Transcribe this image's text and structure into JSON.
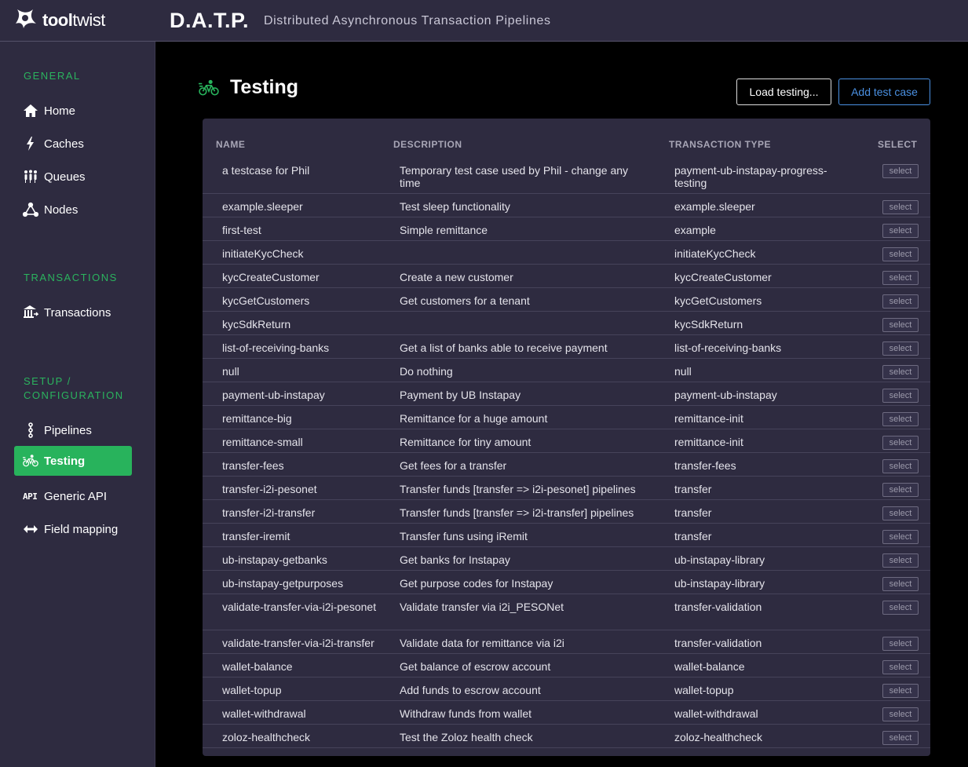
{
  "header": {
    "logo_text_bold": "tool",
    "logo_text_light": "twist",
    "app_title": "D.A.T.P.",
    "app_subtitle": "Distributed Asynchronous Transaction Pipelines"
  },
  "colors": {
    "header_bg": "#2e2b40",
    "accent_green": "#28b35c",
    "link_blue": "#4a90e2"
  },
  "sidebar": {
    "sections": [
      {
        "title": "GENERAL"
      },
      {
        "title": "TRANSACTIONS"
      },
      {
        "title": "SETUP /",
        "title2": "CONFIGURATION"
      }
    ],
    "items": [
      {
        "label": "Home",
        "icon": "home-icon"
      },
      {
        "label": "Caches",
        "icon": "bolt-icon"
      },
      {
        "label": "Queues",
        "icon": "people-icon"
      },
      {
        "label": "Nodes",
        "icon": "nodes-icon"
      },
      {
        "label": "Transactions",
        "icon": "bank-icon"
      },
      {
        "label": "Pipelines",
        "icon": "pipeline-icon"
      },
      {
        "label": "Testing",
        "icon": "bicycle-icon",
        "active": true
      },
      {
        "label": "Generic API",
        "icon": "api-icon",
        "icon_text": "API"
      },
      {
        "label": "Field mapping",
        "icon": "arrows-icon"
      }
    ]
  },
  "page": {
    "title": "Testing",
    "load_button": "Load testing...",
    "add_button": "Add test case"
  },
  "table": {
    "headers": {
      "name": "NAME",
      "description": "DESCRIPTION",
      "type": "TRANSACTION TYPE",
      "select": "SELECT"
    },
    "select_label": "select",
    "rows": [
      {
        "name": "a testcase for Phil",
        "description": "Temporary test case used by Phil - change any time",
        "type": "payment-ub-instapay-progress-testing"
      },
      {
        "name": "example.sleeper",
        "description": "Test sleep functionality",
        "type": "example.sleeper"
      },
      {
        "name": "first-test",
        "description": "Simple remittance",
        "type": "example"
      },
      {
        "name": "initiateKycCheck",
        "description": "",
        "type": "initiateKycCheck"
      },
      {
        "name": "kycCreateCustomer",
        "description": "Create a new customer",
        "type": "kycCreateCustomer"
      },
      {
        "name": "kycGetCustomers",
        "description": "Get customers for a tenant",
        "type": "kycGetCustomers"
      },
      {
        "name": "kycSdkReturn",
        "description": "",
        "type": "kycSdkReturn"
      },
      {
        "name": "list-of-receiving-banks",
        "description": "Get a list of banks able to receive payment",
        "type": "list-of-receiving-banks"
      },
      {
        "name": "null",
        "description": "Do nothing",
        "type": "null"
      },
      {
        "name": "payment-ub-instapay",
        "description": "Payment by UB Instapay",
        "type": "payment-ub-instapay"
      },
      {
        "name": "remittance-big",
        "description": "Remittance for a huge amount",
        "type": "remittance-init"
      },
      {
        "name": "remittance-small",
        "description": "Remittance for tiny amount",
        "type": "remittance-init"
      },
      {
        "name": "transfer-fees",
        "description": "Get fees for a transfer",
        "type": "transfer-fees"
      },
      {
        "name": "transfer-i2i-pesonet",
        "description": "Transfer funds [transfer => i2i-pesonet] pipelines",
        "type": "transfer"
      },
      {
        "name": "transfer-i2i-transfer",
        "description": "Transfer funds [transfer => i2i-transfer] pipelines",
        "type": "transfer"
      },
      {
        "name": "transfer-iremit",
        "description": "Transfer funs using iRemit",
        "type": "transfer"
      },
      {
        "name": "ub-instapay-getbanks",
        "description": "Get banks for Instapay",
        "type": "ub-instapay-library"
      },
      {
        "name": "ub-instapay-getpurposes",
        "description": "Get purpose codes for Instapay",
        "type": "ub-instapay-library"
      },
      {
        "name": "validate-transfer-via-i2i-pesonet",
        "description": "Validate transfer via i2i_PESONet",
        "type": "transfer-validation"
      },
      {
        "name": "validate-transfer-via-i2i-transfer",
        "description": "Validate data for remittance via i2i",
        "type": "transfer-validation"
      },
      {
        "name": "wallet-balance",
        "description": "Get balance of escrow account",
        "type": "wallet-balance"
      },
      {
        "name": "wallet-topup",
        "description": "Add funds to escrow account",
        "type": "wallet-topup"
      },
      {
        "name": "wallet-withdrawal",
        "description": "Withdraw funds from wallet",
        "type": "wallet-withdrawal"
      },
      {
        "name": "zoloz-healthcheck",
        "description": "Test the Zoloz health check",
        "type": "zoloz-healthcheck"
      }
    ]
  }
}
